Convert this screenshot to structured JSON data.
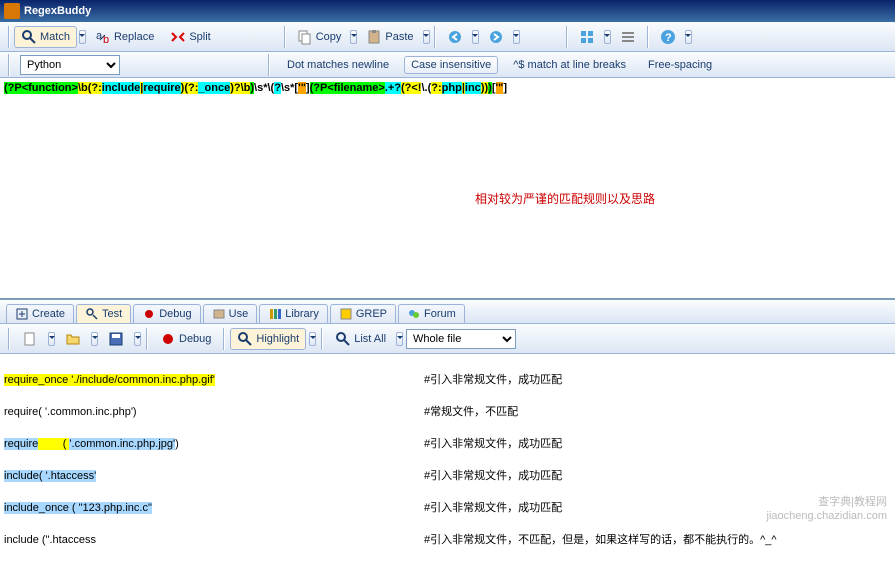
{
  "title": "RegexBuddy",
  "toolbar": {
    "match": "Match",
    "replace": "Replace",
    "split": "Split",
    "copy": "Copy",
    "paste": "Paste"
  },
  "optbar": {
    "flavor": "Python",
    "dot": "Dot matches newline",
    "caseins": "Case insensitive",
    "lineb": "^$ match at line breaks",
    "freesp": "Free-spacing"
  },
  "regex": {
    "t1": "(?P<function>",
    "t2": "\\b(?:",
    "t3": "include",
    "t4": "|",
    "t5": "require",
    "t6": ")(?:",
    "t7": "_once",
    "t8": ")?\\b",
    "t9": ")",
    "t10": "\\s*\\(",
    "t11": "?",
    "t12": "\\s*[",
    "t13": "'\"",
    "t14": "]",
    "t15": "(?P<filename>",
    "t16": ".+?",
    "t17": "(?<!",
    "t18": "\\.(",
    "t19": "?:",
    "t20": "php",
    "t21": "|",
    "t22": "inc",
    "t23": ")",
    "t24": ")",
    "t25": ")",
    "t26": "[",
    "t27": "'\"",
    "t28": "]"
  },
  "annotation": "相对较为严谨的匹配规则以及思路",
  "tabs": {
    "create": "Create",
    "test": "Test",
    "debug": "Debug",
    "use": "Use",
    "library": "Library",
    "grep": "GREP",
    "forum": "Forum"
  },
  "testbar": {
    "debug": "Debug",
    "highlight": "Highlight",
    "listall": "List All",
    "scope": "Whole file"
  },
  "test": {
    "l1": {
      "code": "require_once './include/common.inc.php.gif'",
      "cm": "#引入非常规文件，成功匹配"
    },
    "l2": {
      "code": "require( '.common.inc.php')",
      "cm": "#常规文件，不匹配"
    },
    "l3": {
      "code_a": "require",
      "code_b": "        ( ",
      "code_c": "'.common.inc.php.jpg'",
      "code_d": ")",
      "cm": "#引入非常规文件，成功匹配"
    },
    "l4": {
      "code_a": "include( ",
      "code_b": "'.htaccess'",
      "cm": "#引入非常规文件，成功匹配"
    },
    "l5": {
      "code_a": "include_once ( ",
      "code_b": "\"123.php.inc.c\"",
      "cm": "#引入非常规文件，成功匹配"
    },
    "l6": {
      "code": "include (\".htaccess",
      "cm": "#引入非常规文件，不匹配，但是，如果这样写的话，都不能执行的。^_^"
    }
  },
  "watermark": {
    "a": "查字典|教程网",
    "b": "jiaocheng.chazidian.com"
  }
}
